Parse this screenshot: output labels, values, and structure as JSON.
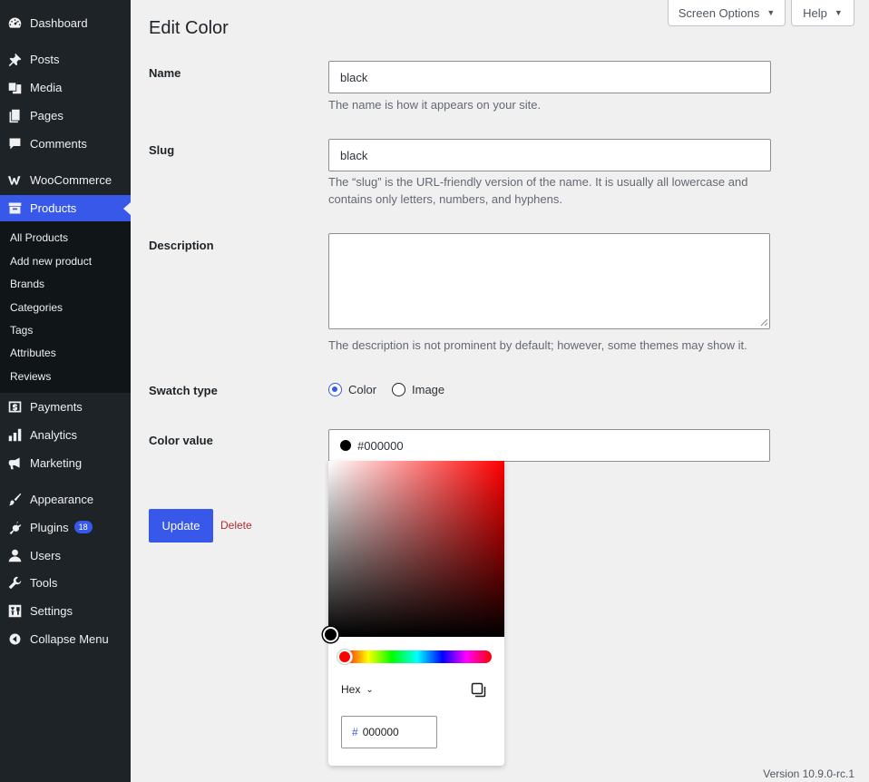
{
  "menu": {
    "items": [
      {
        "label": "Dashboard",
        "icon": "dashboard-icon"
      },
      {
        "label": "Posts",
        "icon": "pin-icon"
      },
      {
        "label": "Media",
        "icon": "media-icon"
      },
      {
        "label": "Pages",
        "icon": "pages-icon"
      },
      {
        "label": "Comments",
        "icon": "comment-icon"
      },
      {
        "label": "WooCommerce",
        "icon": "woocommerce-icon"
      },
      {
        "label": "Products",
        "icon": "archive-icon"
      },
      {
        "label": "Payments",
        "icon": "payments-icon"
      },
      {
        "label": "Analytics",
        "icon": "bar-chart-icon"
      },
      {
        "label": "Marketing",
        "icon": "megaphone-icon"
      },
      {
        "label": "Appearance",
        "icon": "brush-icon"
      },
      {
        "label": "Plugins",
        "icon": "plug-icon",
        "badge": "18"
      },
      {
        "label": "Users",
        "icon": "user-icon"
      },
      {
        "label": "Tools",
        "icon": "wrench-icon"
      },
      {
        "label": "Settings",
        "icon": "settings-icon"
      },
      {
        "label": "Collapse Menu",
        "icon": "collapse-icon"
      }
    ],
    "submenu": [
      "All Products",
      "Add new product",
      "Brands",
      "Categories",
      "Tags",
      "Attributes",
      "Reviews"
    ]
  },
  "top": {
    "screen_options": "Screen Options",
    "help": "Help",
    "caret": "▼"
  },
  "page": {
    "title": "Edit Color"
  },
  "form": {
    "name_label": "Name",
    "name_value": "black",
    "name_desc": "The name is how it appears on your site.",
    "slug_label": "Slug",
    "slug_value": "black",
    "slug_desc": "The “slug” is the URL-friendly version of the name. It is usually all lowercase and contains only letters, numbers, and hyphens.",
    "description_label": "Description",
    "description_value": "",
    "description_desc": "The description is not prominent by default; however, some themes may show it.",
    "swatch_label": "Swatch type",
    "swatch_color": "Color",
    "swatch_image": "Image",
    "color_label": "Color value",
    "color_value": "#000000",
    "update_button": "Update",
    "delete_link": "Delete"
  },
  "picker": {
    "format": "Hex",
    "chevron": "⌄",
    "hash": "#",
    "hex_value": "000000"
  },
  "footer": {
    "version": "Version 10.9.0-rc.1"
  },
  "colors": {
    "sidebar": "#1d2327",
    "submenu": "#101517",
    "accent": "#3858e9",
    "delete": "#b32d2e",
    "background": "#f0f0f1"
  }
}
